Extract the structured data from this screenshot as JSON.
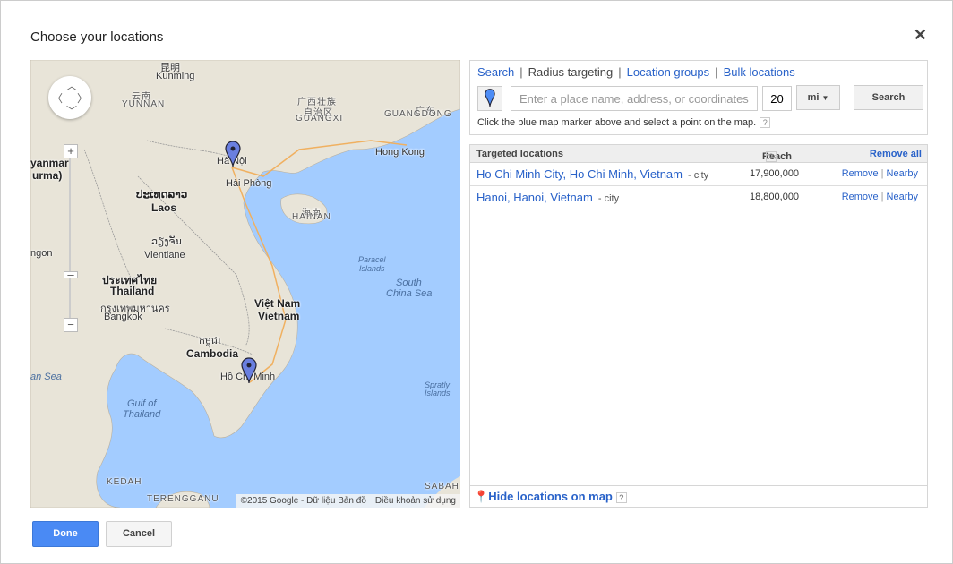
{
  "dialog": {
    "title": "Choose your locations",
    "close_icon": "close-icon"
  },
  "map": {
    "labels": [
      {
        "t": "昆明",
        "c": "",
        "l": 145,
        "tp": 0
      },
      {
        "t": "Kunming",
        "c": "",
        "l": 140,
        "tp": 12
      },
      {
        "t": "云南",
        "c": "caps",
        "l": 113,
        "tp": 32
      },
      {
        "t": "YUNNAN",
        "c": "caps",
        "l": 102,
        "tp": 44
      },
      {
        "t": "广西壮族",
        "c": "caps",
        "l": 298,
        "tp": 38
      },
      {
        "t": "自治区",
        "c": "caps",
        "l": 305,
        "tp": 50
      },
      {
        "t": "GUANGXI",
        "c": "caps",
        "l": 296,
        "tp": 60
      },
      {
        "t": "广东",
        "c": "caps",
        "l": 430,
        "tp": 48
      },
      {
        "t": "GUANGDONG",
        "c": "caps",
        "l": 395,
        "tp": 55
      },
      {
        "t": "Hong Kong",
        "c": "",
        "l": 385,
        "tp": 97
      },
      {
        "t": "Hà Nội",
        "c": "",
        "l": 208,
        "tp": 107
      },
      {
        "t": "Hải Phòng",
        "c": "",
        "l": 218,
        "tp": 132
      },
      {
        "t": "海南",
        "c": "caps",
        "l": 303,
        "tp": 162
      },
      {
        "t": "HAINAN",
        "c": "caps",
        "l": 292,
        "tp": 170
      },
      {
        "t": "ປະເທດລາວ",
        "c": "b",
        "l": 118,
        "tp": 143
      },
      {
        "t": "Laos",
        "c": "b",
        "l": 135,
        "tp": 158
      },
      {
        "t": "ວຽງຈັນ",
        "c": "",
        "l": 135,
        "tp": 196
      },
      {
        "t": "Vientiane",
        "c": "",
        "l": 127,
        "tp": 212
      },
      {
        "t": "ประเทศไทย",
        "c": "b",
        "l": 80,
        "tp": 237
      },
      {
        "t": "Thailand",
        "c": "b",
        "l": 89,
        "tp": 251
      },
      {
        "t": "กรุงเทพมหานคร",
        "c": "",
        "l": 78,
        "tp": 268
      },
      {
        "t": "Bangkok",
        "c": "",
        "l": 82,
        "tp": 281
      },
      {
        "t": "Việt Nam",
        "c": "b",
        "l": 250,
        "tp": 265
      },
      {
        "t": "Vietnam",
        "c": "b",
        "l": 254,
        "tp": 279
      },
      {
        "t": "Paracel",
        "c": "small",
        "l": 366,
        "tp": 218
      },
      {
        "t": "Islands",
        "c": "small",
        "l": 367,
        "tp": 228
      },
      {
        "t": "South",
        "c": "sea",
        "l": 408,
        "tp": 243
      },
      {
        "t": "China Sea",
        "c": "sea",
        "l": 397,
        "tp": 255
      },
      {
        "t": "កម្ពុជា",
        "c": "",
        "l": 188,
        "tp": 307
      },
      {
        "t": "Cambodia",
        "c": "b",
        "l": 174,
        "tp": 321
      },
      {
        "t": "Hồ Chí Minh",
        "c": "",
        "l": 212,
        "tp": 348
      },
      {
        "t": "Gulf of",
        "c": "sea",
        "l": 108,
        "tp": 378
      },
      {
        "t": "Thailand",
        "c": "sea",
        "l": 103,
        "tp": 390
      },
      {
        "t": "Spratly",
        "c": "small",
        "l": 440,
        "tp": 358
      },
      {
        "t": "Islands",
        "c": "small",
        "l": 440,
        "tp": 367
      },
      {
        "t": "an Sea",
        "c": "sea",
        "l": 0,
        "tp": 348
      },
      {
        "t": "yanmar",
        "c": "b",
        "l": 0,
        "tp": 108
      },
      {
        "t": "urma)",
        "c": "b",
        "l": 2,
        "tp": 122
      },
      {
        "t": "ngon",
        "c": "",
        "l": 0,
        "tp": 210
      },
      {
        "t": "KEDAH",
        "c": "caps",
        "l": 85,
        "tp": 466
      },
      {
        "t": "TERENGGANU",
        "c": "caps",
        "l": 130,
        "tp": 485
      },
      {
        "t": "SABAH",
        "c": "caps",
        "l": 440,
        "tp": 471
      }
    ],
    "attribution": "©2015 Google - Dữ liệu Bản đồ",
    "terms": "Điều khoản sử dụng",
    "sea_color": "#a3ccff",
    "land_color": "#e8e4d8"
  },
  "search_panel": {
    "tabs": [
      {
        "label": "Search",
        "active": false
      },
      {
        "label": "Radius targeting",
        "active": true
      },
      {
        "label": "Location groups",
        "active": false
      },
      {
        "label": "Bulk locations",
        "active": false
      }
    ],
    "placeholder": "Enter a place name, address, or coordinates",
    "radius": "20",
    "unit": "mi",
    "search_label": "Search",
    "hint": "Click the blue map marker above and select a point on the map.",
    "help": "?"
  },
  "targeted": {
    "header": "Targeted locations",
    "reach_header": "Reach",
    "help": "?",
    "remove_all": "Remove all",
    "rows": [
      {
        "name": "Ho Chi Minh City, Ho Chi Minh, Vietnam",
        "type": "- city",
        "reach": "17,900,000",
        "remove": "Remove",
        "nearby": "Nearby"
      },
      {
        "name": "Hanoi, Hanoi, Vietnam",
        "type": "- city",
        "reach": "18,800,000",
        "remove": "Remove",
        "nearby": "Nearby"
      }
    ],
    "hide_label": "Hide locations on map"
  },
  "footer": {
    "done": "Done",
    "cancel": "Cancel"
  },
  "colors": {
    "accent": "#4a8af4",
    "link": "#2962c9"
  }
}
